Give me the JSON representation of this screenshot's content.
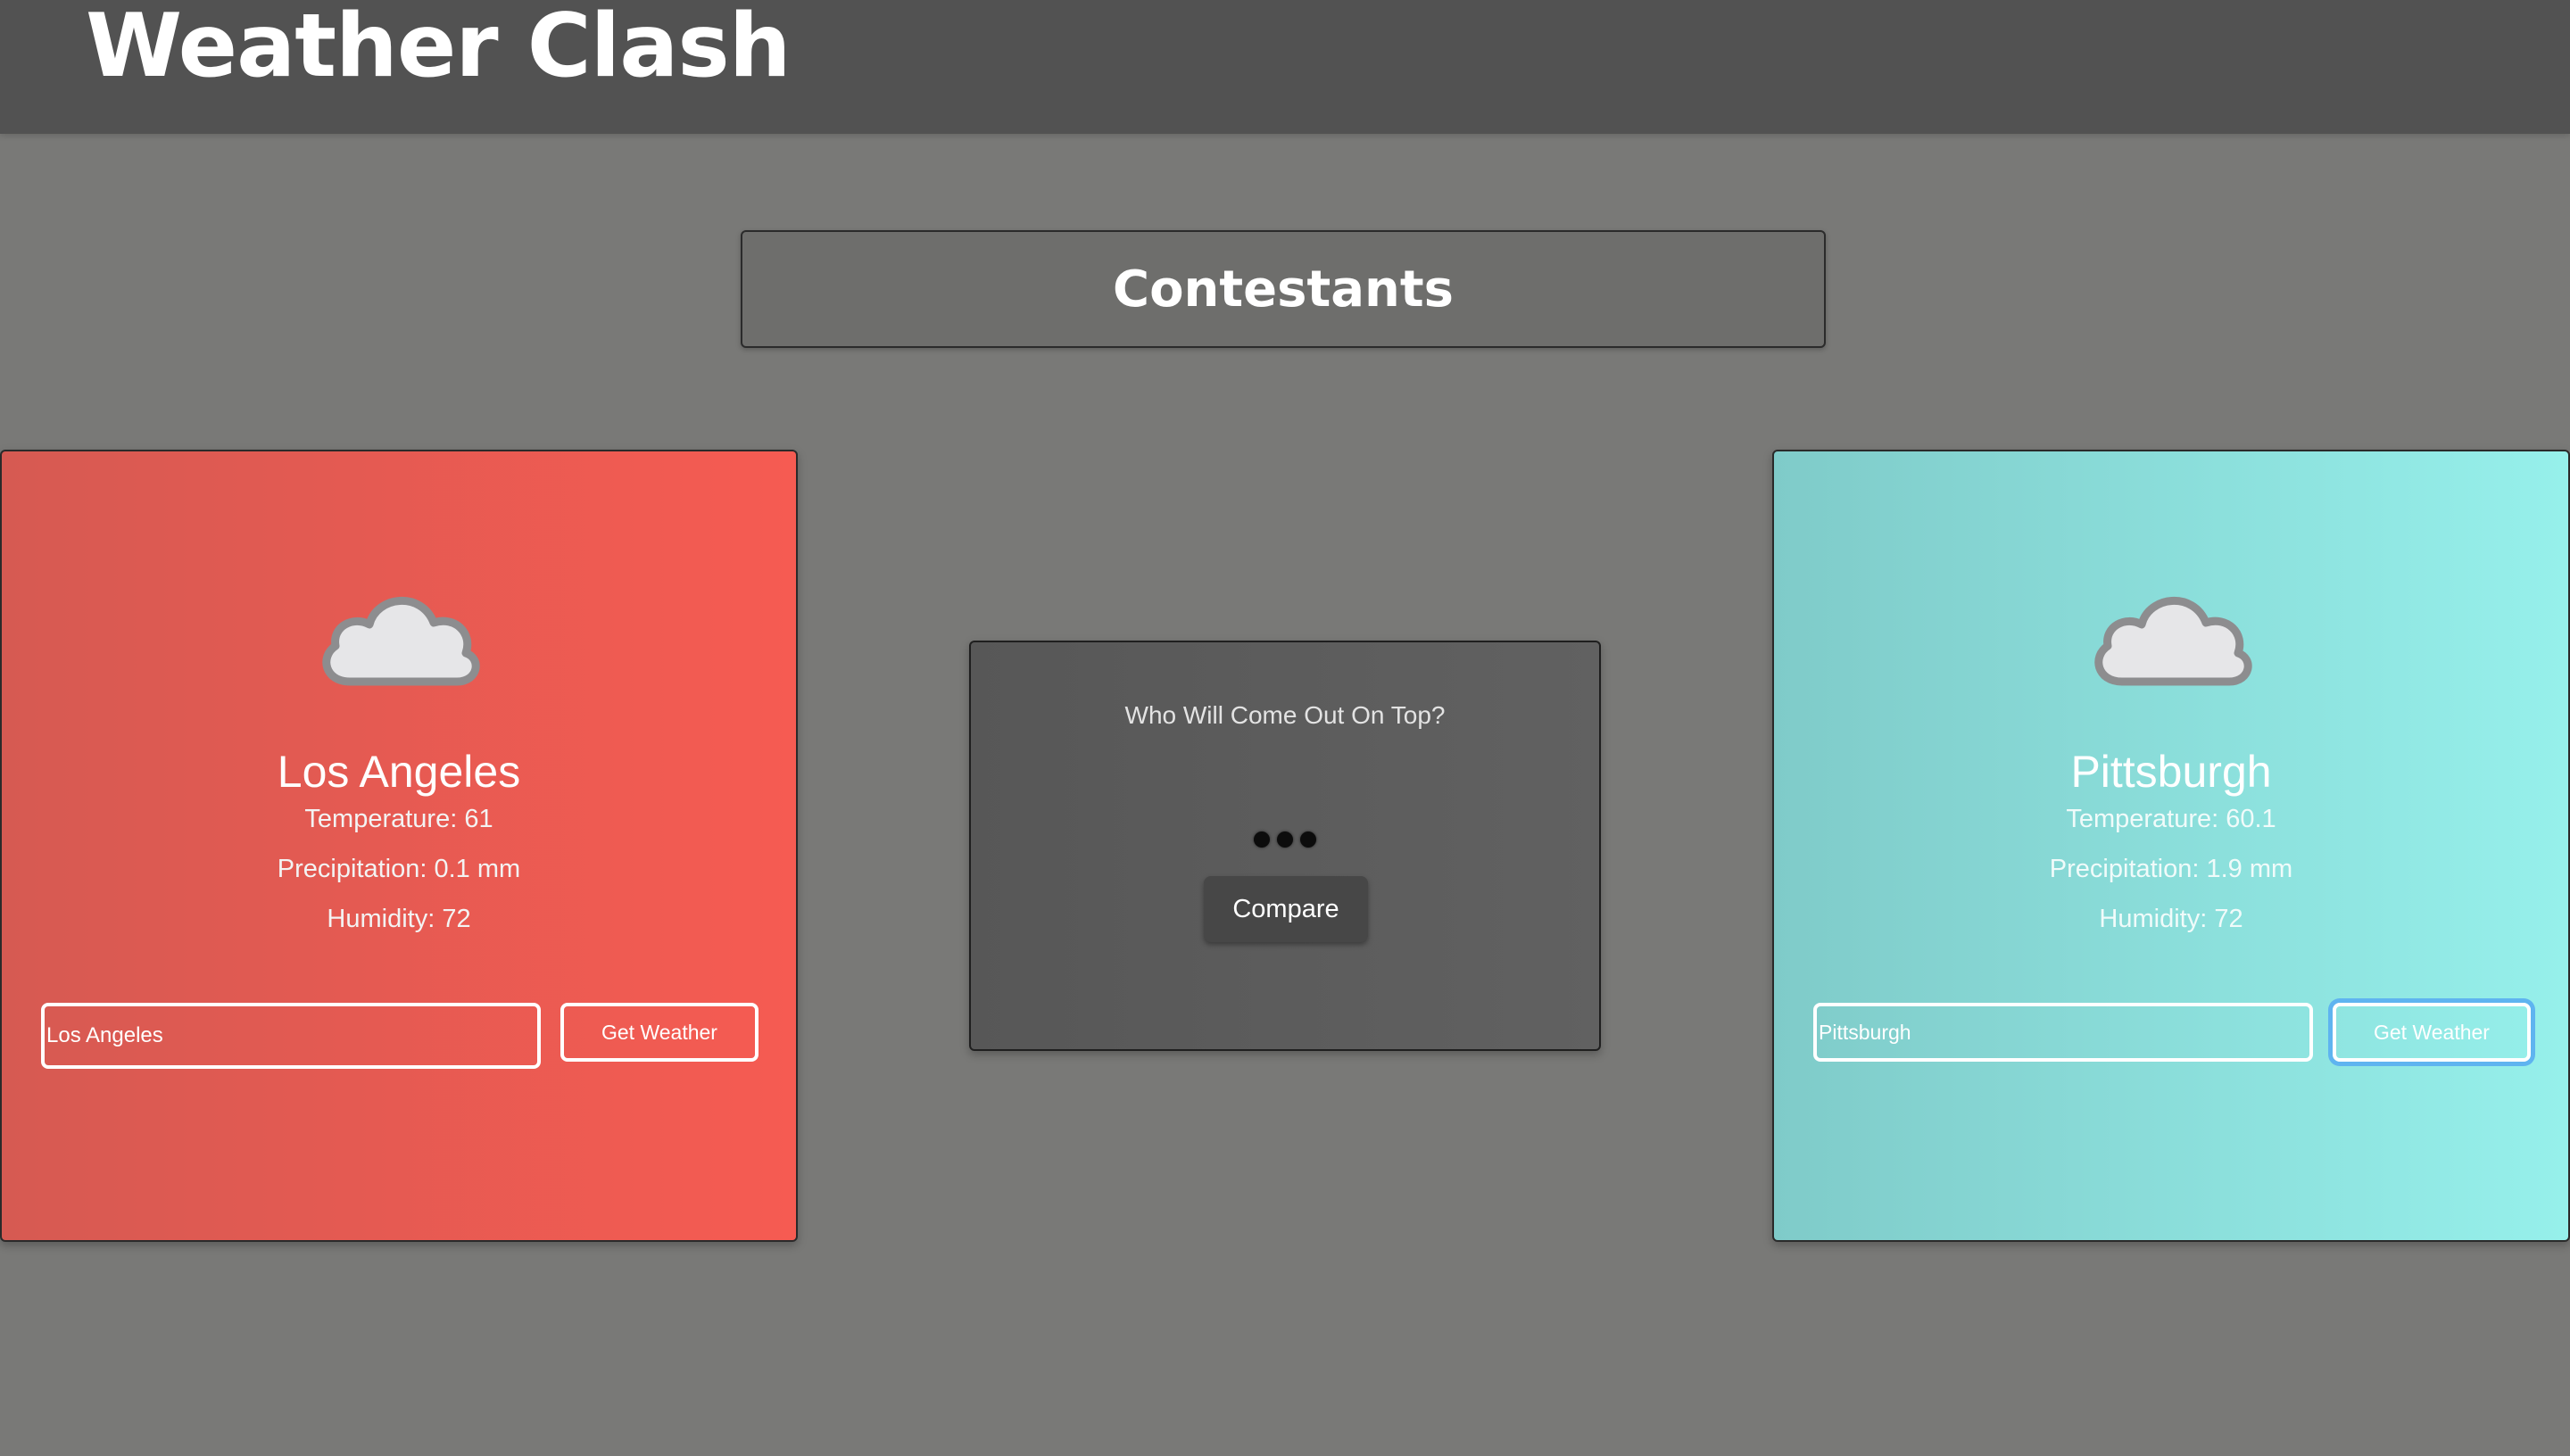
{
  "header": {
    "title": "Weather Clash"
  },
  "contestants": {
    "title": "Contestants"
  },
  "compare": {
    "question": "Who Will Come Out On Top?",
    "button_label": "Compare",
    "loading_indicator": "three-dot-loading-icon"
  },
  "left_card": {
    "icon": "cloud-icon",
    "city": "Los Angeles",
    "temperature": "Temperature: 61",
    "precipitation": "Precipitation: 0.1 mm",
    "humidity": "Humidity: 72",
    "input_value": "Los Angeles",
    "button_label": "Get Weather",
    "accent_color": "#f65b52"
  },
  "right_card": {
    "icon": "cloud-icon",
    "city": "Pittsburgh",
    "temperature": "Temperature: 60.1",
    "precipitation": "Precipitation: 1.9 mm",
    "humidity": "Humidity: 72",
    "input_value": "Pittsburgh",
    "button_label": "Get Weather",
    "accent_color": "#96f0eb"
  }
}
